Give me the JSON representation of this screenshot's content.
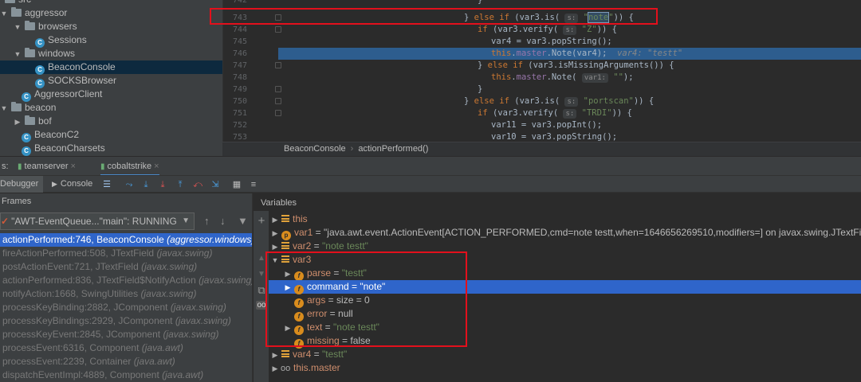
{
  "project_tree": {
    "items": [
      {
        "label": "src",
        "type": "folder",
        "indent": 0,
        "expanded": true
      },
      {
        "label": "aggressor",
        "type": "folder",
        "indent": 0,
        "expanded": true
      },
      {
        "label": "browsers",
        "type": "folder",
        "indent": 1,
        "expanded": true
      },
      {
        "label": "Sessions",
        "type": "class",
        "indent": 2
      },
      {
        "label": "windows",
        "type": "folder",
        "indent": 1,
        "expanded": true
      },
      {
        "label": "BeaconConsole",
        "type": "class",
        "indent": 2,
        "selected": true
      },
      {
        "label": "SOCKSBrowser",
        "type": "class",
        "indent": 2
      },
      {
        "label": "AggressorClient",
        "type": "class",
        "indent": 1
      },
      {
        "label": "beacon",
        "type": "folder",
        "indent": 0,
        "expanded": true
      },
      {
        "label": "bof",
        "type": "folder",
        "indent": 1,
        "expanded": false
      },
      {
        "label": "BeaconC2",
        "type": "class",
        "indent": 1
      },
      {
        "label": "BeaconCharsets",
        "type": "class",
        "indent": 1
      }
    ]
  },
  "editor": {
    "line_numbers": [
      "742",
      "743",
      "744",
      "745",
      "746",
      "747",
      "748",
      "749",
      "750",
      "751",
      "752",
      "753"
    ],
    "lines": {
      "l742_close": "}",
      "l743_a": "} ",
      "l743_else": "else if",
      "l743_b": " (var3.is( ",
      "l743_hint": "s:",
      "l743_q1": " \"",
      "l743_note": "note",
      "l743_q2": "\"",
      "l743_c": ")) {",
      "l744_if": "if",
      "l744_a": " (var3.verify( ",
      "l744_hint": "s:",
      "l744_str": " \"Z\"",
      "l744_b": ")) {",
      "l745": "var4 = var3.popString();",
      "l746_this": "this",
      "l746_dot": ".",
      "l746_master": "master",
      "l746_call": ".Note(var4);",
      "l746_inline": "var4: \"testt\"",
      "l747_a": "} ",
      "l747_else": "else if",
      "l747_b": " (var3.isMissingArguments()) {",
      "l748_this": "this",
      "l748_dot": ".",
      "l748_master": "master",
      "l748_call": ".Note( ",
      "l748_hint": "var1:",
      "l748_str": " \"\"",
      "l748_end": ");",
      "l749_close": "}",
      "l750_a": "} ",
      "l750_else": "else if",
      "l750_b": " (var3.is( ",
      "l750_hint": "s:",
      "l750_str": " \"portscan\"",
      "l750_c": ")) {",
      "l751_if": "if",
      "l751_a": " (var3.verify( ",
      "l751_hint": "s:",
      "l751_str": " \"TRDI\"",
      "l751_b": ")) {",
      "l752": "var11 = var3.popInt();",
      "l753": "var10 = var3.popString();"
    },
    "breadcrumb": [
      "BeaconConsole",
      "actionPerformed()"
    ]
  },
  "run_tabs": {
    "prefix": "s:",
    "tabs": [
      {
        "label": "teamserver"
      },
      {
        "label": "cobaltstrike",
        "active": true
      }
    ]
  },
  "debugger_toolbar": {
    "tabs": [
      {
        "label": "Debugger",
        "active": true
      },
      {
        "label": "Console"
      }
    ]
  },
  "frames": {
    "title": "Frames",
    "thread": "\"AWT-EventQueue...\"main\": RUNNING",
    "items": [
      {
        "method": "actionPerformed:746, BeaconConsole",
        "pkg": "(aggressor.windows)",
        "selected": true
      },
      {
        "method": "fireActionPerformed:508, JTextField",
        "pkg": "(javax.swing)"
      },
      {
        "method": "postActionEvent:721, JTextField",
        "pkg": "(javax.swing)"
      },
      {
        "method": "actionPerformed:836, JTextField$NotifyAction",
        "pkg": "(javax.swing)"
      },
      {
        "method": "notifyAction:1668, SwingUtilities",
        "pkg": "(javax.swing)"
      },
      {
        "method": "processKeyBinding:2882, JComponent",
        "pkg": "(javax.swing)"
      },
      {
        "method": "processKeyBindings:2929, JComponent",
        "pkg": "(javax.swing)"
      },
      {
        "method": "processKeyEvent:2845, JComponent",
        "pkg": "(javax.swing)"
      },
      {
        "method": "processEvent:6316, Component",
        "pkg": "(java.awt)"
      },
      {
        "method": "processEvent:2239, Container",
        "pkg": "(java.awt)"
      },
      {
        "method": "dispatchEventImpl:4889, Component",
        "pkg": "(java.awt)"
      }
    ]
  },
  "variables": {
    "title": "Variables",
    "items": [
      {
        "name": "this",
        "value": ""
      },
      {
        "name": "var1",
        "value": "\"java.awt.event.ActionEvent[ACTION_PERFORMED,cmd=note testt,when=1646656269510,modifiers=] on javax.swing.JTextField"
      },
      {
        "name": "var2",
        "value": "\"note testt\""
      },
      {
        "name": "var3",
        "value": ""
      },
      {
        "name": "parse",
        "value": "\"testt\""
      },
      {
        "name": "command",
        "value": "\"note\""
      },
      {
        "name": "args",
        "value": "size = 0"
      },
      {
        "name": "error",
        "value": "null"
      },
      {
        "name": "text",
        "value": "\"note testt\""
      },
      {
        "name": "missing",
        "value": "false"
      },
      {
        "name": "var4",
        "value": "\"testt\""
      },
      {
        "name": "this.master",
        "value": ""
      }
    ],
    "eq": " = "
  },
  "colors": {
    "selection": "#2f65ca",
    "editor_highlight": "#2d5d8e",
    "annotation_red": "#e3101c"
  }
}
